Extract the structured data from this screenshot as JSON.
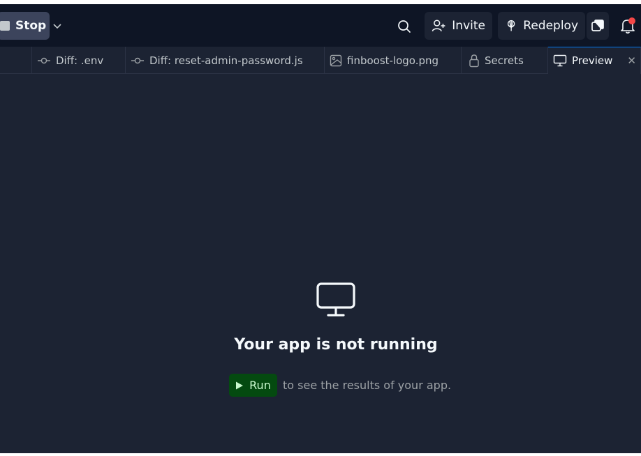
{
  "topbar": {
    "stop_label": "Stop",
    "invite_label": "Invite",
    "redeploy_label": "Redeploy"
  },
  "tabs": [
    {
      "label": "Diff: .env",
      "icon": "git-commit-icon"
    },
    {
      "label": "Diff: reset-admin-password.js",
      "icon": "git-commit-icon"
    },
    {
      "label": "finboost-logo.png",
      "icon": "image-icon"
    },
    {
      "label": "Secrets",
      "icon": "lock-icon"
    },
    {
      "label": "Preview",
      "icon": "monitor-icon",
      "active": true
    }
  ],
  "main": {
    "title": "Your app is not running",
    "run_label": "Run",
    "run_suffix": "to see the results of your app."
  },
  "colors": {
    "background": "#1c2333",
    "topbar": "#0e1525",
    "run_button": "#044a10",
    "notification_dot": "#f44747"
  }
}
